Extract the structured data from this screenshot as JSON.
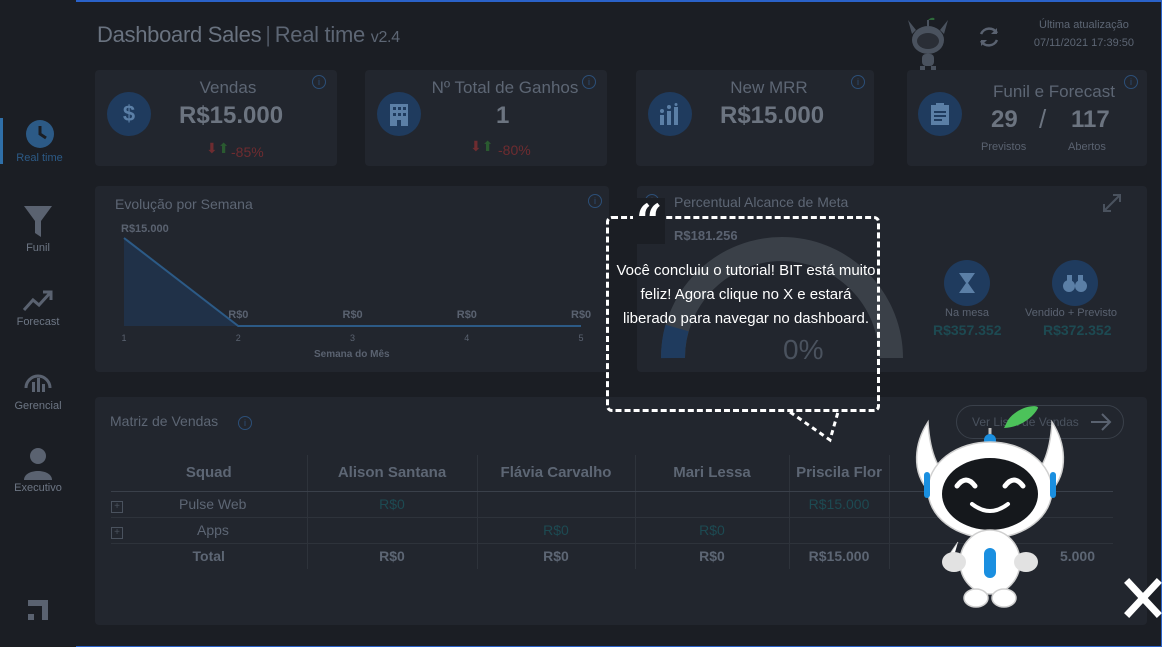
{
  "header": {
    "title_main": "Dashboard Sales",
    "title_sub": "Real time",
    "version": "v2.4",
    "update_label": "Última atualização",
    "update_time": "07/11/2021 17:39:50"
  },
  "sidebar": {
    "items": [
      {
        "label": "Real time",
        "icon": "clock-icon"
      },
      {
        "label": "Funil",
        "icon": "funnel-icon"
      },
      {
        "label": "Forecast",
        "icon": "trend-up-icon"
      },
      {
        "label": "Gerencial",
        "icon": "gauge-chart-icon"
      },
      {
        "label": "Executivo",
        "icon": "user-icon"
      }
    ]
  },
  "kpis": {
    "vendas": {
      "title": "Vendas",
      "value": "R$15.000",
      "pct": "-85%"
    },
    "ganhos": {
      "title": "Nº Total de Ganhos",
      "value": "1",
      "pct": "-80%"
    },
    "mrr": {
      "title": "New MRR",
      "value": "R$15.000"
    },
    "funil": {
      "title": "Funil e Forecast",
      "previstos": "29",
      "previstos_label": "Previstos",
      "sep": "/",
      "abertos": "117",
      "abertos_label": "Abertos"
    }
  },
  "evolucao": {
    "title": "Evolução por Semana",
    "xlabel": "Semana do Mês"
  },
  "chart_data": {
    "type": "area",
    "x": [
      1,
      2,
      3,
      4,
      5
    ],
    "values": [
      15000,
      0,
      0,
      0,
      0
    ],
    "data_labels": [
      "R$15.000",
      "R$0",
      "R$0",
      "R$0",
      "R$0"
    ],
    "xlabel": "Semana do Mês",
    "ylabel": ""
  },
  "meta": {
    "title": "Percentual Alcance de Meta",
    "value": "R$181.256",
    "gauge_pct": "0%",
    "na_mesa_label": "Na mesa",
    "na_mesa_value": "R$357.352",
    "vendido_label": "Vendido + Previsto",
    "vendido_value": "R$372.352"
  },
  "matriz": {
    "title": "Matriz de Vendas",
    "button": "Ver Lista de Vendas",
    "headers": [
      "Squad",
      "Alison Santana",
      "Flávia Carvalho",
      "Mari Lessa",
      "Priscila Flor"
    ],
    "rows": [
      {
        "expand": "+",
        "cells": [
          "Pulse Web",
          "R$0",
          "",
          "",
          "R$15.000"
        ]
      },
      {
        "expand": "+",
        "cells": [
          "Apps",
          "",
          "R$0",
          "R$0",
          ""
        ]
      },
      {
        "expand": "",
        "cells": [
          "Total",
          "R$0",
          "R$0",
          "R$0",
          "R$15.000"
        ]
      }
    ],
    "extra_total": "5.000"
  },
  "tutorial": {
    "quote": "“",
    "message": "Você concluiu o tutorial! BIT está muito feliz! Agora clique no X  e estará liberado para navegar no dashboard."
  },
  "colors": {
    "accent": "#2f6fa8",
    "negative": "#b0303a",
    "positive": "#2a9a3a",
    "overlay_text": "#ffffff"
  }
}
